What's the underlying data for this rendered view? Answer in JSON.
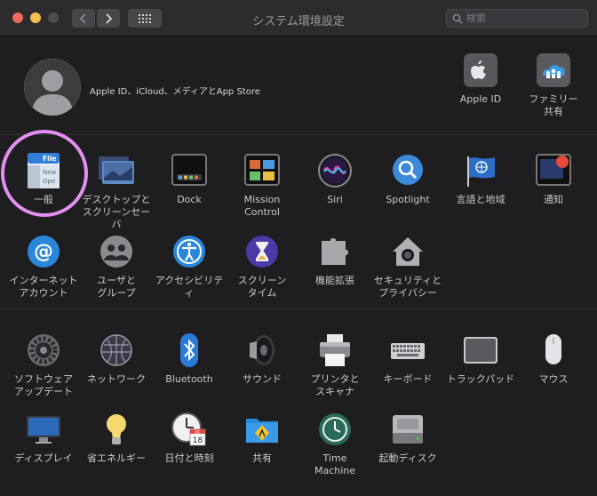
{
  "window": {
    "title": "システム環境設定"
  },
  "search": {
    "placeholder": "検索",
    "value": ""
  },
  "account": {
    "label": "Apple ID、iCloud、メディアとApp Store"
  },
  "top_right": [
    {
      "id": "apple-id",
      "label": "Apple ID"
    },
    {
      "id": "family",
      "label": "ファミリー\n共有"
    }
  ],
  "row1": [
    {
      "id": "general",
      "label": "一般"
    },
    {
      "id": "desktop",
      "label": "デスクトップと\nスクリーンセーバ"
    },
    {
      "id": "dock",
      "label": "Dock"
    },
    {
      "id": "mission-control",
      "label": "Mission\nControl"
    },
    {
      "id": "siri",
      "label": "Siri"
    },
    {
      "id": "spotlight",
      "label": "Spotlight"
    },
    {
      "id": "language",
      "label": "言語と地域"
    },
    {
      "id": "notifications",
      "label": "通知"
    }
  ],
  "row2": [
    {
      "id": "internet-accounts",
      "label": "インターネット\nアカウント"
    },
    {
      "id": "users",
      "label": "ユーザと\nグループ"
    },
    {
      "id": "accessibility",
      "label": "アクセシビリティ"
    },
    {
      "id": "screen-time",
      "label": "スクリーン\nタイム"
    },
    {
      "id": "extensions",
      "label": "機能拡張"
    },
    {
      "id": "security",
      "label": "セキュリティと\nプライバシー"
    }
  ],
  "row3": [
    {
      "id": "software-update",
      "label": "ソフトウェア\nアップデート"
    },
    {
      "id": "network",
      "label": "ネットワーク"
    },
    {
      "id": "bluetooth",
      "label": "Bluetooth"
    },
    {
      "id": "sound",
      "label": "サウンド"
    },
    {
      "id": "printers",
      "label": "プリンタと\nスキャナ"
    },
    {
      "id": "keyboard",
      "label": "キーボード"
    },
    {
      "id": "trackpad",
      "label": "トラックパッド"
    },
    {
      "id": "mouse",
      "label": "マウス"
    }
  ],
  "row4": [
    {
      "id": "displays",
      "label": "ディスプレイ"
    },
    {
      "id": "energy",
      "label": "省エネルギー"
    },
    {
      "id": "date-time",
      "label": "日付と時刻"
    },
    {
      "id": "sharing",
      "label": "共有"
    },
    {
      "id": "time-machine",
      "label": "Time\nMachine"
    },
    {
      "id": "startup-disk",
      "label": "起動ディスク"
    }
  ],
  "general_icon": {
    "line1": "File",
    "line2": "New",
    "line3": "Ope"
  },
  "calendar_icon": {
    "month": "JUL",
    "day": "18"
  },
  "colors": {
    "highlight": "#e28ff0",
    "accent": "#2f88e6"
  }
}
